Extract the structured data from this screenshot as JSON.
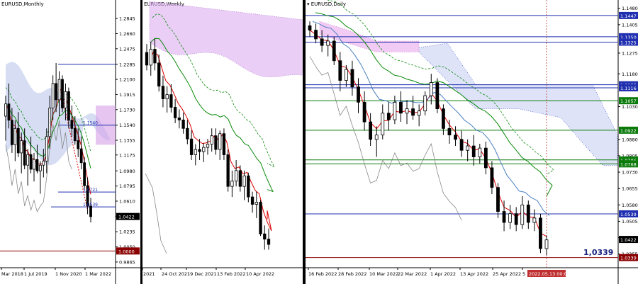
{
  "chart_data": [
    {
      "type": "candlestick",
      "title": "EURUSD,Monthly",
      "x_ticks": [
        "Mar 2018",
        "1 Jul 2019",
        "1 Nov 2020",
        "1 Mar 2022"
      ],
      "y_ticks": [
        "1.2845",
        "1.2660",
        "1.2475",
        "1.2285",
        "1.2100",
        "1.1915",
        "1.1730",
        "1.1540",
        "1.1355",
        "1.1175",
        "1.0980",
        "1.0795",
        "1.0610",
        "1.0425",
        "1.0235",
        "1.0050",
        "0.9865"
      ],
      "ylim": [
        0.9795,
        1.2985
      ],
      "current_price": "1.0422",
      "current_price_value": 1.0422,
      "level_labels": [
        {
          "label": "1.0721",
          "value": 1.0721
        },
        {
          "label": "1.0539",
          "value": 1.0539
        },
        {
          "label": "1.1540",
          "value": 1.154
        },
        {
          "label": "1.0000",
          "value": 1.0
        }
      ],
      "candles": [
        {
          "o": 1.165,
          "h": 1.19,
          "l": 1.135,
          "c": 1.18
        },
        {
          "o": 1.18,
          "h": 1.205,
          "l": 1.15,
          "c": 1.16
        },
        {
          "o": 1.16,
          "h": 1.175,
          "l": 1.12,
          "c": 1.13
        },
        {
          "o": 1.13,
          "h": 1.16,
          "l": 1.11,
          "c": 1.15
        },
        {
          "o": 1.15,
          "h": 1.17,
          "l": 1.115,
          "c": 1.12
        },
        {
          "o": 1.12,
          "h": 1.145,
          "l": 1.095,
          "c": 1.135
        },
        {
          "o": 1.135,
          "h": 1.15,
          "l": 1.1,
          "c": 1.105
        },
        {
          "o": 1.105,
          "h": 1.125,
          "l": 1.08,
          "c": 1.118
        },
        {
          "o": 1.118,
          "h": 1.14,
          "l": 1.095,
          "c": 1.1
        },
        {
          "o": 1.1,
          "h": 1.12,
          "l": 1.085,
          "c": 1.112
        },
        {
          "o": 1.112,
          "h": 1.13,
          "l": 1.095,
          "c": 1.098
        },
        {
          "o": 1.098,
          "h": 1.11,
          "l": 1.07,
          "c": 1.105
        },
        {
          "o": 1.105,
          "h": 1.125,
          "l": 1.09,
          "c": 1.11
        },
        {
          "o": 1.11,
          "h": 1.15,
          "l": 1.095,
          "c": 1.14
        },
        {
          "o": 1.14,
          "h": 1.19,
          "l": 1.125,
          "c": 1.175
        },
        {
          "o": 1.175,
          "h": 1.215,
          "l": 1.16,
          "c": 1.205
        },
        {
          "o": 1.205,
          "h": 1.23,
          "l": 1.17,
          "c": 1.185
        },
        {
          "o": 1.185,
          "h": 1.22,
          "l": 1.165,
          "c": 1.21
        },
        {
          "o": 1.21,
          "h": 1.215,
          "l": 1.17,
          "c": 1.175
        },
        {
          "o": 1.175,
          "h": 1.205,
          "l": 1.16,
          "c": 1.195
        },
        {
          "o": 1.195,
          "h": 1.2,
          "l": 1.15,
          "c": 1.16
        },
        {
          "o": 1.16,
          "h": 1.178,
          "l": 1.14,
          "c": 1.15
        },
        {
          "o": 1.15,
          "h": 1.165,
          "l": 1.13,
          "c": 1.135
        },
        {
          "o": 1.135,
          "h": 1.15,
          "l": 1.115,
          "c": 1.125
        },
        {
          "o": 1.125,
          "h": 1.14,
          "l": 1.1,
          "c": 1.108
        },
        {
          "o": 1.108,
          "h": 1.115,
          "l": 1.075,
          "c": 1.08
        },
        {
          "o": 1.08,
          "h": 1.09,
          "l": 1.045,
          "c": 1.055
        },
        {
          "o": 1.055,
          "h": 1.065,
          "l": 1.035,
          "c": 1.042
        }
      ]
    },
    {
      "type": "candlestick",
      "title": "EURUSD,Weekly",
      "x_ticks": [
        "2021",
        "24 Oct 2021",
        "19 Dec 2021",
        "13 Feb 2022",
        "10 Apr 2022"
      ],
      "ylim": [
        0.9795,
        1.2985
      ],
      "candles": [
        {
          "o": 1.222,
          "h": 1.23,
          "l": 1.205,
          "c": 1.21
        },
        {
          "o": 1.21,
          "h": 1.232,
          "l": 1.2,
          "c": 1.225
        },
        {
          "o": 1.225,
          "h": 1.235,
          "l": 1.205,
          "c": 1.212
        },
        {
          "o": 1.212,
          "h": 1.22,
          "l": 1.185,
          "c": 1.19
        },
        {
          "o": 1.19,
          "h": 1.2,
          "l": 1.17,
          "c": 1.178
        },
        {
          "o": 1.178,
          "h": 1.19,
          "l": 1.165,
          "c": 1.182
        },
        {
          "o": 1.182,
          "h": 1.192,
          "l": 1.165,
          "c": 1.17
        },
        {
          "o": 1.17,
          "h": 1.178,
          "l": 1.155,
          "c": 1.16
        },
        {
          "o": 1.16,
          "h": 1.168,
          "l": 1.15,
          "c": 1.158
        },
        {
          "o": 1.158,
          "h": 1.165,
          "l": 1.145,
          "c": 1.15
        },
        {
          "o": 1.15,
          "h": 1.158,
          "l": 1.135,
          "c": 1.14
        },
        {
          "o": 1.14,
          "h": 1.148,
          "l": 1.12,
          "c": 1.125
        },
        {
          "o": 1.125,
          "h": 1.135,
          "l": 1.115,
          "c": 1.13
        },
        {
          "o": 1.13,
          "h": 1.14,
          "l": 1.12,
          "c": 1.128
        },
        {
          "o": 1.128,
          "h": 1.136,
          "l": 1.118,
          "c": 1.132
        },
        {
          "o": 1.132,
          "h": 1.14,
          "l": 1.125,
          "c": 1.135
        },
        {
          "o": 1.135,
          "h": 1.15,
          "l": 1.128,
          "c": 1.143
        },
        {
          "o": 1.143,
          "h": 1.15,
          "l": 1.125,
          "c": 1.13
        },
        {
          "o": 1.13,
          "h": 1.148,
          "l": 1.12,
          "c": 1.145
        },
        {
          "o": 1.145,
          "h": 1.15,
          "l": 1.12,
          "c": 1.125
        },
        {
          "o": 1.125,
          "h": 1.13,
          "l": 1.09,
          "c": 1.095
        },
        {
          "o": 1.095,
          "h": 1.11,
          "l": 1.085,
          "c": 1.1
        },
        {
          "o": 1.1,
          "h": 1.12,
          "l": 1.095,
          "c": 1.11
        },
        {
          "o": 1.11,
          "h": 1.115,
          "l": 1.09,
          "c": 1.095
        },
        {
          "o": 1.095,
          "h": 1.11,
          "l": 1.082,
          "c": 1.105
        },
        {
          "o": 1.105,
          "h": 1.108,
          "l": 1.08,
          "c": 1.085
        },
        {
          "o": 1.085,
          "h": 1.09,
          "l": 1.07,
          "c": 1.078
        },
        {
          "o": 1.078,
          "h": 1.09,
          "l": 1.065,
          "c": 1.08
        },
        {
          "o": 1.08,
          "h": 1.082,
          "l": 1.048,
          "c": 1.05
        },
        {
          "o": 1.05,
          "h": 1.058,
          "l": 1.035,
          "c": 1.045
        },
        {
          "o": 1.045,
          "h": 1.055,
          "l": 1.035,
          "c": 1.04
        }
      ]
    },
    {
      "type": "candlestick",
      "title": "EURUSD,Daily",
      "x_ticks": [
        "16 Feb 2022",
        "28 Feb 2022",
        "10 Mar 2022",
        "22 Mar 2022",
        "1 Apr 2022",
        "13 Apr 2022",
        "25 Apr 2022",
        "5"
      ],
      "current_date_label": "2022.05.13 00:00",
      "y_ticks": [
        "1.1480",
        "1.1405",
        "1.1275",
        "1.1180",
        "1.1030",
        "1.0880",
        "1.0805",
        "1.0730",
        "1.0655",
        "1.0580",
        "1.0505",
        "1.0430",
        "1.0355"
      ],
      "ylim": [
        1.0325,
        1.1505
      ],
      "current_price": "1.0422",
      "current_price_value": 1.0422,
      "big_label": "1,0339",
      "levels": [
        {
          "label": "1.1447",
          "value": 1.1447,
          "color": "#1f2fb0"
        },
        {
          "label": "1.1350",
          "value": 1.135,
          "color": "#1f2fb0"
        },
        {
          "label": "1.1325",
          "value": 1.1325,
          "color": "#1f2fb0"
        },
        {
          "label": "1.1130",
          "value": 1.113,
          "color": "#1f2fb0"
        },
        {
          "label": "1.1116",
          "value": 1.1116,
          "color": "#1f2fb0"
        },
        {
          "label": "1.1057",
          "value": 1.1057,
          "color": "#0a7a0a"
        },
        {
          "label": "1.0922",
          "value": 1.0922,
          "color": "#0a7a0a"
        },
        {
          "label": "1.0786",
          "value": 1.0786,
          "color": "#0a7a0a"
        },
        {
          "label": "1.0768",
          "value": 1.0768,
          "color": "#0a7a0a"
        },
        {
          "label": "1.0539",
          "value": 1.0539,
          "color": "#1f2fb0"
        },
        {
          "label": "1.0339",
          "value": 1.0339,
          "color": "#8b0000"
        }
      ],
      "candles": [
        {
          "o": 1.14,
          "h": 1.142,
          "l": 1.135,
          "c": 1.138
        },
        {
          "o": 1.138,
          "h": 1.141,
          "l": 1.132,
          "c": 1.134
        },
        {
          "o": 1.134,
          "h": 1.138,
          "l": 1.128,
          "c": 1.131
        },
        {
          "o": 1.131,
          "h": 1.136,
          "l": 1.126,
          "c": 1.133
        },
        {
          "o": 1.133,
          "h": 1.135,
          "l": 1.122,
          "c": 1.124
        },
        {
          "o": 1.124,
          "h": 1.128,
          "l": 1.11,
          "c": 1.115
        },
        {
          "o": 1.115,
          "h": 1.122,
          "l": 1.112,
          "c": 1.12
        },
        {
          "o": 1.12,
          "h": 1.124,
          "l": 1.108,
          "c": 1.112
        },
        {
          "o": 1.112,
          "h": 1.116,
          "l": 1.1,
          "c": 1.105
        },
        {
          "o": 1.105,
          "h": 1.11,
          "l": 1.092,
          "c": 1.096
        },
        {
          "o": 1.096,
          "h": 1.1,
          "l": 1.085,
          "c": 1.088
        },
        {
          "o": 1.088,
          "h": 1.094,
          "l": 1.08,
          "c": 1.09
        },
        {
          "o": 1.09,
          "h": 1.104,
          "l": 1.088,
          "c": 1.1
        },
        {
          "o": 1.1,
          "h": 1.105,
          "l": 1.092,
          "c": 1.097
        },
        {
          "o": 1.097,
          "h": 1.108,
          "l": 1.095,
          "c": 1.105
        },
        {
          "o": 1.105,
          "h": 1.11,
          "l": 1.096,
          "c": 1.1
        },
        {
          "o": 1.1,
          "h": 1.106,
          "l": 1.095,
          "c": 1.102
        },
        {
          "o": 1.102,
          "h": 1.108,
          "l": 1.097,
          "c": 1.099
        },
        {
          "o": 1.099,
          "h": 1.104,
          "l": 1.094,
          "c": 1.101
        },
        {
          "o": 1.101,
          "h": 1.11,
          "l": 1.099,
          "c": 1.108
        },
        {
          "o": 1.108,
          "h": 1.118,
          "l": 1.104,
          "c": 1.114
        },
        {
          "o": 1.114,
          "h": 1.116,
          "l": 1.1,
          "c": 1.102
        },
        {
          "o": 1.102,
          "h": 1.104,
          "l": 1.09,
          "c": 1.093
        },
        {
          "o": 1.093,
          "h": 1.097,
          "l": 1.086,
          "c": 1.09
        },
        {
          "o": 1.09,
          "h": 1.094,
          "l": 1.085,
          "c": 1.088
        },
        {
          "o": 1.088,
          "h": 1.092,
          "l": 1.08,
          "c": 1.083
        },
        {
          "o": 1.083,
          "h": 1.088,
          "l": 1.078,
          "c": 1.085
        },
        {
          "o": 1.085,
          "h": 1.09,
          "l": 1.076,
          "c": 1.08
        },
        {
          "o": 1.08,
          "h": 1.086,
          "l": 1.077,
          "c": 1.084
        },
        {
          "o": 1.084,
          "h": 1.087,
          "l": 1.072,
          "c": 1.075
        },
        {
          "o": 1.075,
          "h": 1.078,
          "l": 1.063,
          "c": 1.066
        },
        {
          "o": 1.066,
          "h": 1.068,
          "l": 1.052,
          "c": 1.055
        },
        {
          "o": 1.055,
          "h": 1.06,
          "l": 1.046,
          "c": 1.05
        },
        {
          "o": 1.05,
          "h": 1.058,
          "l": 1.047,
          "c": 1.054
        },
        {
          "o": 1.054,
          "h": 1.057,
          "l": 1.046,
          "c": 1.049
        },
        {
          "o": 1.049,
          "h": 1.062,
          "l": 1.047,
          "c": 1.058
        },
        {
          "o": 1.058,
          "h": 1.06,
          "l": 1.047,
          "c": 1.05
        },
        {
          "o": 1.05,
          "h": 1.056,
          "l": 1.046,
          "c": 1.052
        },
        {
          "o": 1.052,
          "h": 1.054,
          "l": 1.036,
          "c": 1.038
        },
        {
          "o": 1.038,
          "h": 1.044,
          "l": 1.035,
          "c": 1.042
        }
      ]
    }
  ]
}
